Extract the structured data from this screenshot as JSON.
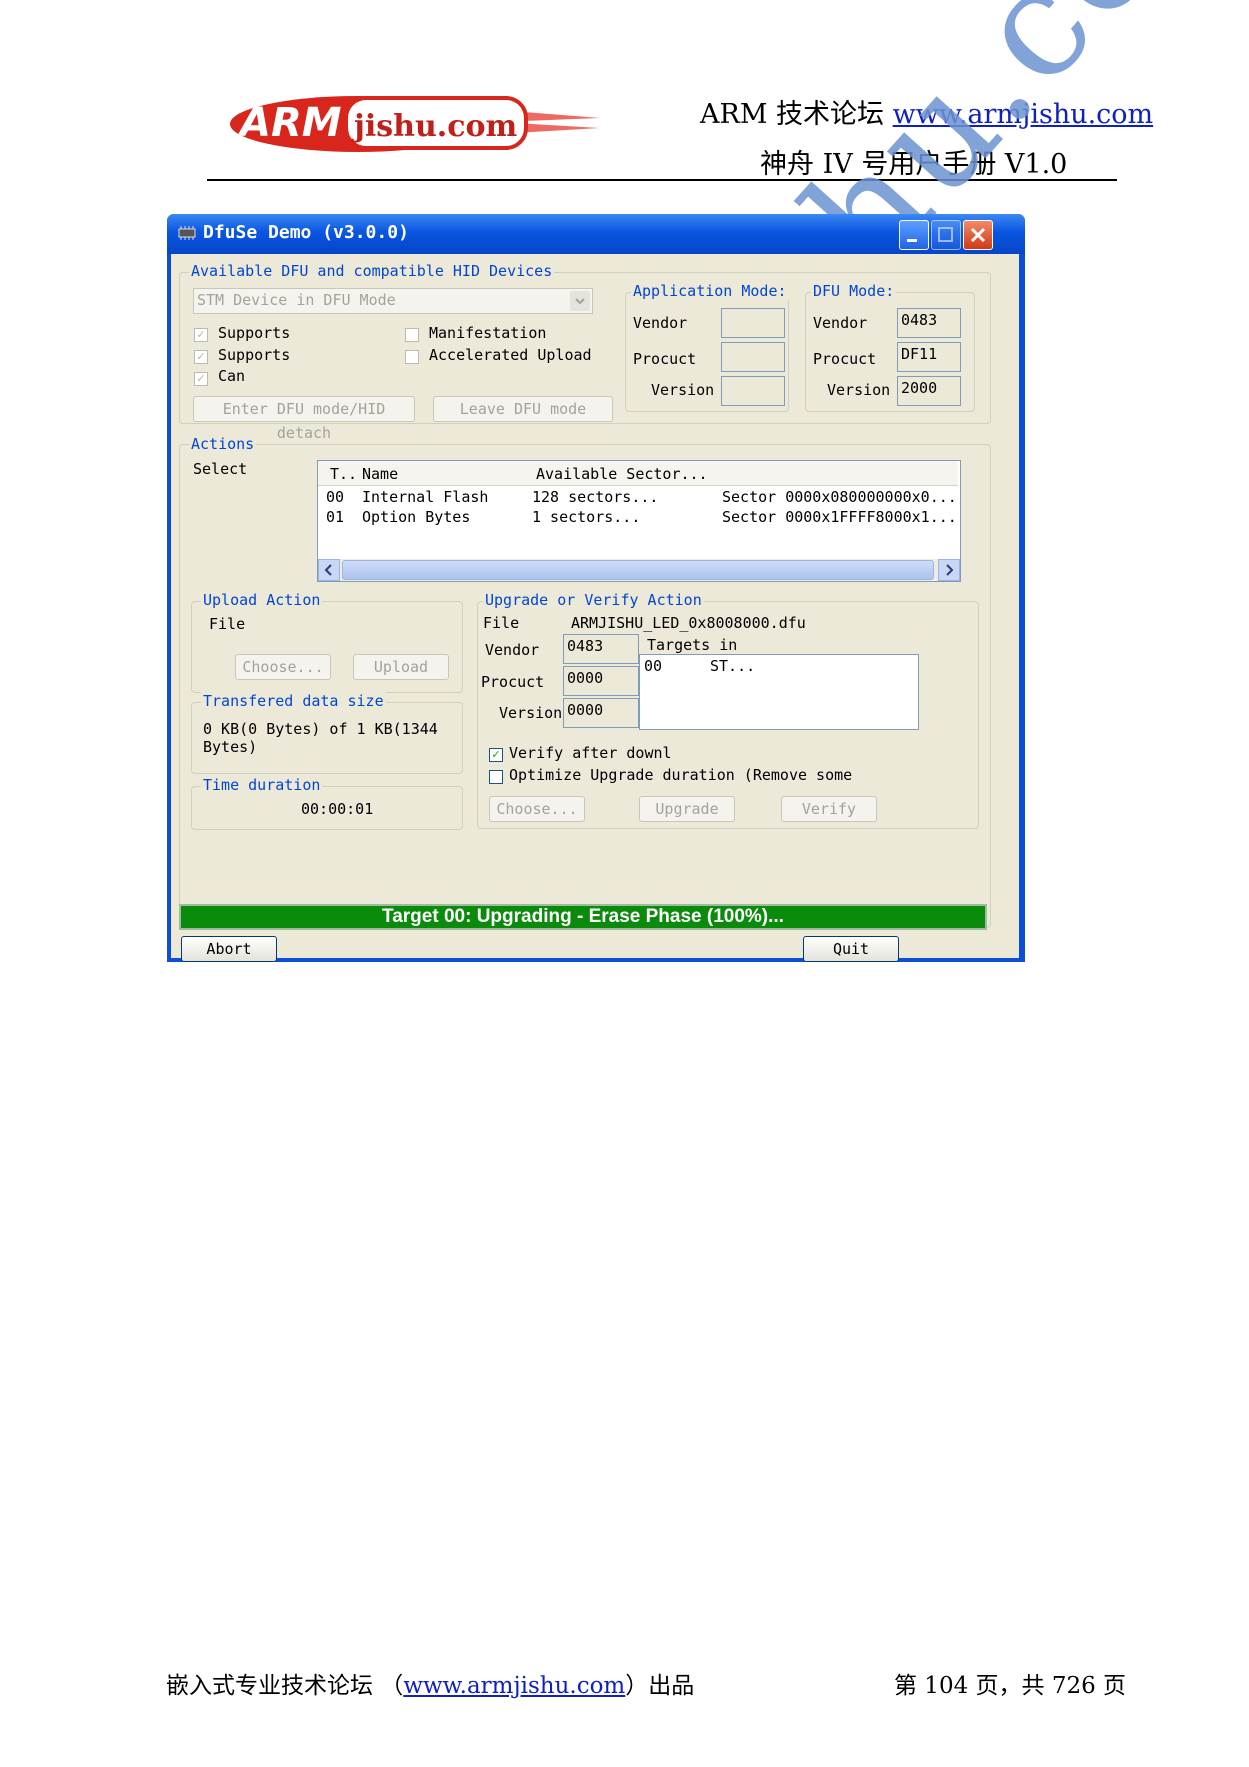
{
  "header": {
    "logo_text": "ARMjishu.com",
    "line1_prefix": "ARM 技术论坛 ",
    "line1_link": "www.armjishu.com",
    "line2": "神舟 IV 号用户手册 V1.0"
  },
  "watermark": "www.armjishu.com",
  "window": {
    "title": "DfuSe Demo (v3.0.0)",
    "title_icon": "chip-icon",
    "devices_group": {
      "title": "Available DFU and compatible HID Devices",
      "device_select": "STM Device in DFU Mode",
      "checkboxes": [
        {
          "label": "Supports",
          "checked": true
        },
        {
          "label": "Supports",
          "checked": true
        },
        {
          "label": "Can",
          "checked": true
        },
        {
          "label": "Manifestation",
          "checked": false
        },
        {
          "label": "Accelerated Upload",
          "checked": false
        }
      ],
      "enter_dfu_button": "Enter DFU mode/HID detach",
      "leave_dfu_button": "Leave DFU mode"
    },
    "app_mode": {
      "title": "Application Mode:",
      "vendor_label": "Vendor",
      "product_label": "Procuct",
      "version_label": "Version",
      "vendor": "",
      "product": "",
      "version": ""
    },
    "dfu_mode": {
      "title": "DFU Mode:",
      "vendor_label": "Vendor",
      "product_label": "Procuct",
      "version_label": "Version",
      "vendor": "0483",
      "product": "DF11",
      "version": "2000"
    },
    "actions": {
      "title": "Actions",
      "select_label": "Select",
      "columns": [
        "T..",
        "Name",
        "Available Sector..."
      ],
      "rows": [
        {
          "t": "00",
          "name": "Internal Flash",
          "sectors": "128 sectors...",
          "detail": "Sector 0000x080000000x0..."
        },
        {
          "t": "01",
          "name": "Option Bytes",
          "sectors": "1 sectors...",
          "detail": "Sector 0000x1FFFF8000x1..."
        }
      ]
    },
    "upload": {
      "title": "Upload Action",
      "file_label": "File",
      "choose_button": "Choose...",
      "upload_button": "Upload"
    },
    "transfer": {
      "title": "Transfered data size",
      "text": "0 KB(0 Bytes) of 1 KB(1344 Bytes)"
    },
    "duration": {
      "title": "Time duration",
      "value": "00:00:01"
    },
    "upgrade": {
      "title": "Upgrade or Verify Action",
      "file_label": "File",
      "file_value": "ARMJISHU_LED_0x8008000.dfu",
      "vendor_label": "Vendor",
      "vendor": "0483",
      "product_label": "Procuct",
      "product": "0000",
      "version_label": "Version",
      "version": "0000",
      "targets_label": "Targets in",
      "target_id": "00",
      "target_name": "ST...",
      "verify_label": "Verify after downl",
      "verify_checked": true,
      "optimize_label": "Optimize Upgrade duration (Remove some",
      "optimize_checked": false,
      "choose_button": "Choose...",
      "upgrade_button": "Upgrade",
      "verify_button": "Verify"
    },
    "progress": {
      "text": "Target 00: Upgrading - Erase Phase (100%)...",
      "percent": 100,
      "color": "#0b8b0b"
    },
    "abort_button": "Abort",
    "quit_button": "Quit"
  },
  "footer": {
    "left_prefix": "嵌入式专业技术论坛 （",
    "left_link": "www.armjishu.com",
    "left_suffix": "）出品",
    "right": "第 104 页，共 726 页"
  }
}
